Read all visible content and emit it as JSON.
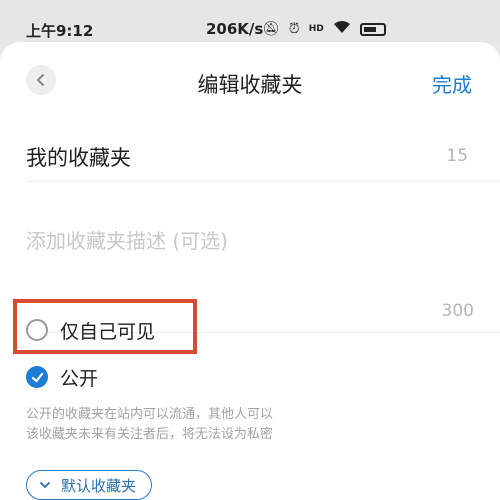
{
  "status_bar": {
    "time": "上午9:12",
    "network_speed": "206K/s",
    "icons": [
      "mute-bell-icon",
      "alarm-icon",
      "hd-icon",
      "wifi-icon",
      "battery-icon"
    ]
  },
  "header": {
    "title": "编辑收藏夹",
    "done_label": "完成"
  },
  "form": {
    "name_value": "我的收藏夹",
    "name_count": "15",
    "description_placeholder": "添加收藏夹描述 (可选)",
    "description_count": "300"
  },
  "visibility": {
    "private_label": "仅自己可见",
    "public_label": "公开",
    "selected": "public",
    "notice_line1": "公开的收藏夹在站内可以流通，其他人可以",
    "notice_line2": "该收藏夹未来有关注者后，将无法设为私密"
  },
  "default_button": {
    "label": "默认收藏夹"
  },
  "colors": {
    "accent": "#1e7bd8",
    "highlight": "#d94b32"
  }
}
